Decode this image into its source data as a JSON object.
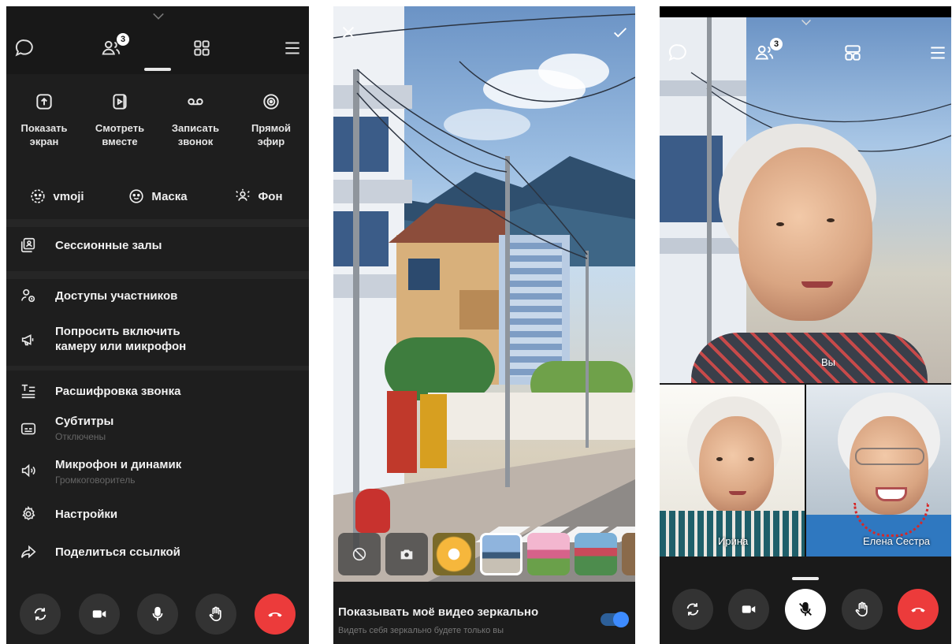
{
  "left_panel": {
    "top_icons": [
      "chat-icon",
      "participants-icon",
      "layout-grid-icon",
      "menu-icon"
    ],
    "participants_badge": "3",
    "actions": [
      {
        "icon": "share-screen-icon",
        "label": "Показать экран"
      },
      {
        "icon": "watch-together-icon",
        "label": "Смотреть вместе"
      },
      {
        "icon": "record-icon",
        "label": "Записать звонок"
      },
      {
        "icon": "live-icon",
        "label": "Прямой эфир"
      }
    ],
    "effects": [
      {
        "icon": "vmoji-icon",
        "label": "vmoji"
      },
      {
        "icon": "mask-icon",
        "label": "Маска"
      },
      {
        "icon": "background-icon",
        "label": "Фон"
      }
    ],
    "menu": {
      "session_rooms": "Сессионные залы",
      "participant_access": "Доступы участников",
      "ask_camera_line1": "Попросить включить",
      "ask_camera_line2": "камеру или микрофон",
      "transcript": "Расшифровка звонка",
      "subtitles": "Субтитры",
      "subtitles_status": "Отключены",
      "mic_speaker": "Микрофон и динамик",
      "mic_speaker_status": "Громкоговоритель",
      "settings": "Настройки",
      "share_link": "Поделиться ссылкой"
    }
  },
  "middle_panel": {
    "mirror_title": "Показывать моё видео зеркально",
    "mirror_subtitle": "Видеть себя зеркально будете только вы",
    "mirror_enabled": true,
    "accent_color": "#3d8bff"
  },
  "right_panel": {
    "participants_badge": "3",
    "main_label": "Вы",
    "tiles": [
      {
        "name": "Ирина"
      },
      {
        "name": "Елена Сестра"
      }
    ]
  },
  "colors": {
    "end_call": "#ec3b3b",
    "panel_bg": "#1e1e1e"
  }
}
